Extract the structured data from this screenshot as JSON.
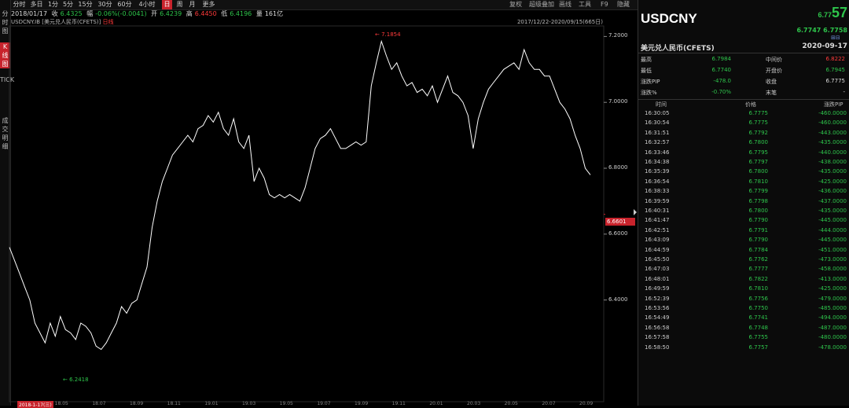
{
  "left_nav": [
    "分时图",
    "K线图",
    "TICK",
    "成交明细"
  ],
  "toolbar": {
    "tabs": [
      "分时",
      "多日",
      "1分",
      "5分",
      "15分",
      "30分",
      "60分",
      "4小时",
      "日",
      "周",
      "月",
      "更多"
    ],
    "active_tab": "日",
    "right_items": [
      "复权",
      "超级叠加",
      "画线",
      "工具",
      "F9",
      "隐藏"
    ]
  },
  "info_row": {
    "date": "2018/01/17",
    "close_label": "收",
    "close_val": "6.4325",
    "change_label": "幅",
    "change_val": "-0.06%(-0.0041)",
    "open_label": "开",
    "open_val": "6.4239",
    "high_label": "高",
    "high_val": "6.4450",
    "low_label": "低",
    "low_val": "6.4196",
    "vol_label": "量",
    "vol_val": "161亿"
  },
  "chart_info": {
    "symbol": "USDCNY.IB",
    "name": "[美元兑人民币(CFETS)]",
    "period": "日线",
    "range": "2017/12/22-2020/09/15(665日)"
  },
  "chart_data": {
    "type": "line",
    "title": "",
    "ylim": [
      6.17,
      7.22
    ],
    "y_ticks": [
      "7.2000",
      "7.0000",
      "6.8000",
      "6.6000",
      "6.4000"
    ],
    "x_ticks": [
      "2018-1-17(三)",
      "18.05",
      "18.07",
      "18.09",
      "18.11",
      "19.01",
      "19.03",
      "19.05",
      "19.07",
      "19.09",
      "19.11",
      "20.01",
      "20.03",
      "20.05",
      "20.07",
      "20.09"
    ],
    "max_label": "7.1854",
    "min_label": "6.2418",
    "current_price": "6.6601",
    "series": [
      {
        "values": [
          6.56,
          6.52,
          6.48,
          6.44,
          6.4,
          6.33,
          6.3,
          6.27,
          6.33,
          6.29,
          6.35,
          6.31,
          6.3,
          6.28,
          6.33,
          6.32,
          6.3,
          6.26,
          6.25,
          6.27,
          6.3,
          6.33,
          6.38,
          6.36,
          6.39,
          6.4,
          6.45,
          6.5,
          6.62,
          6.7,
          6.76,
          6.8,
          6.84,
          6.86,
          6.88,
          6.9,
          6.88,
          6.92,
          6.93,
          6.96,
          6.94,
          6.97,
          6.92,
          6.9,
          6.95,
          6.88,
          6.86,
          6.9,
          6.76,
          6.8,
          6.77,
          6.72,
          6.71,
          6.72,
          6.71,
          6.72,
          6.71,
          6.7,
          6.74,
          6.8,
          6.86,
          6.89,
          6.9,
          6.92,
          6.89,
          6.86,
          6.86,
          6.87,
          6.88,
          6.87,
          6.88,
          7.05,
          7.12,
          7.1854,
          7.14,
          7.1,
          7.12,
          7.08,
          7.05,
          7.06,
          7.03,
          7.04,
          7.02,
          7.05,
          7.0,
          7.04,
          7.08,
          7.03,
          7.02,
          7.0,
          6.96,
          6.86,
          6.95,
          7.0,
          7.04,
          7.06,
          7.08,
          7.1,
          7.11,
          7.12,
          7.1,
          7.16,
          7.12,
          7.1,
          7.1,
          7.08,
          7.08,
          7.04,
          7.0,
          6.98,
          6.95,
          6.9,
          6.86,
          6.8,
          6.78
        ]
      }
    ]
  },
  "quote_panel": {
    "symbol": "USDCNY",
    "price_prefix": "6.77",
    "price_big": "57",
    "bid": "6.7747",
    "ask": "6.7758",
    "name": "美元兑人民币(CFETS)",
    "date": "2020-09-17",
    "stats": [
      {
        "label": "最高",
        "value": "6.7984",
        "color": "#2ec44b"
      },
      {
        "label": "中间价",
        "value": "6.8222",
        "color": "#ff3b3b"
      },
      {
        "label": "最低",
        "value": "6.7740",
        "color": "#2ec44b"
      },
      {
        "label": "开盘价",
        "value": "6.7945",
        "color": "#2ec44b"
      },
      {
        "label": "涨跌PIP",
        "value": "-478.0",
        "color": "#2ec44b"
      },
      {
        "label": "收盘",
        "value": "6.7775",
        "color": "#dddddd"
      },
      {
        "label": "涨跌%",
        "value": "-0.70%",
        "color": "#2ec44b"
      },
      {
        "label": "末笔",
        "value": "-",
        "color": "#dddddd"
      }
    ],
    "tick_headers": [
      "时间",
      "价格",
      "涨跌PIP"
    ],
    "ticks": [
      {
        "time": "16:30:05",
        "price": "6.7775",
        "pip": "-460.0000"
      },
      {
        "time": "16:30:54",
        "price": "6.7775",
        "pip": "-460.0000"
      },
      {
        "time": "16:31:51",
        "price": "6.7792",
        "pip": "-443.0000"
      },
      {
        "time": "16:32:57",
        "price": "6.7800",
        "pip": "-435.0000"
      },
      {
        "time": "16:33:46",
        "price": "6.7795",
        "pip": "-440.0000"
      },
      {
        "time": "16:34:38",
        "price": "6.7797",
        "pip": "-438.0000"
      },
      {
        "time": "16:35:39",
        "price": "6.7800",
        "pip": "-435.0000"
      },
      {
        "time": "16:36:54",
        "price": "6.7810",
        "pip": "-425.0000"
      },
      {
        "time": "16:38:33",
        "price": "6.7799",
        "pip": "-436.0000"
      },
      {
        "time": "16:39:59",
        "price": "6.7798",
        "pip": "-437.0000"
      },
      {
        "time": "16:40:31",
        "price": "6.7800",
        "pip": "-435.0000"
      },
      {
        "time": "16:41:47",
        "price": "6.7790",
        "pip": "-445.0000"
      },
      {
        "time": "16:42:51",
        "price": "6.7791",
        "pip": "-444.0000"
      },
      {
        "time": "16:43:09",
        "price": "6.7790",
        "pip": "-445.0000"
      },
      {
        "time": "16:44:59",
        "price": "6.7784",
        "pip": "-451.0000"
      },
      {
        "time": "16:45:50",
        "price": "6.7762",
        "pip": "-473.0000"
      },
      {
        "time": "16:47:03",
        "price": "6.7777",
        "pip": "-458.0000"
      },
      {
        "time": "16:48:01",
        "price": "6.7822",
        "pip": "-413.0000"
      },
      {
        "time": "16:49:59",
        "price": "6.7810",
        "pip": "-425.0000"
      },
      {
        "time": "16:52:39",
        "price": "6.7756",
        "pip": "-479.0000"
      },
      {
        "time": "16:53:56",
        "price": "6.7750",
        "pip": "-485.0000"
      },
      {
        "time": "16:54:49",
        "price": "6.7741",
        "pip": "-494.0000"
      },
      {
        "time": "16:56:58",
        "price": "6.7748",
        "pip": "-487.0000"
      },
      {
        "time": "16:57:58",
        "price": "6.7755",
        "pip": "-480.0000"
      },
      {
        "time": "16:58:50",
        "price": "6.7757",
        "pip": "-478.0000"
      }
    ]
  }
}
